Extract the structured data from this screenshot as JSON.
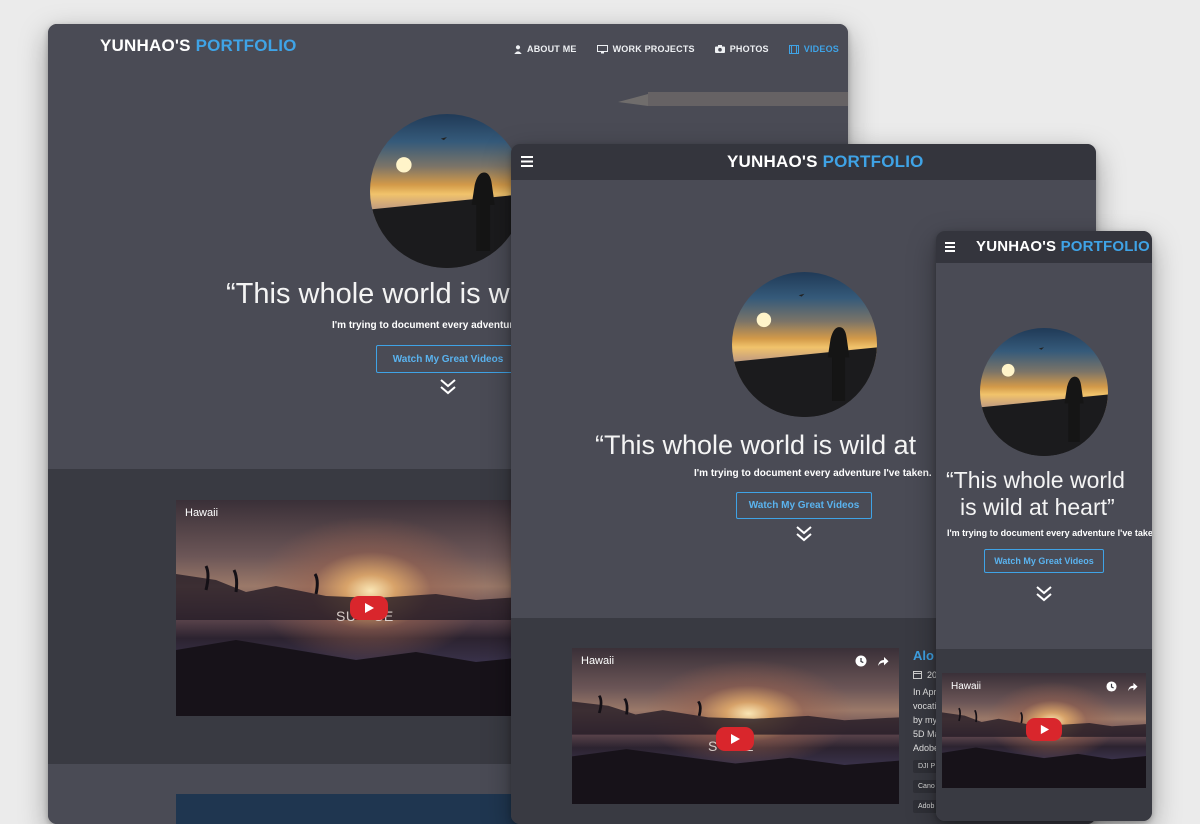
{
  "brand": {
    "name_prefix": "YUNHAO'S",
    "name_accent": "PORTFOLIO"
  },
  "nav": [
    {
      "label": "ABOUT ME",
      "icon": "person-icon"
    },
    {
      "label": "WORK PROJECTS",
      "icon": "monitor-icon"
    },
    {
      "label": "PHOTOS",
      "icon": "camera-icon"
    },
    {
      "label": "VIDEOS",
      "icon": "film-icon",
      "active": true
    }
  ],
  "hero": {
    "quote_desktop": "“This whole world is w",
    "quote_tablet": "“This whole world is wild at",
    "quote_mobile_line1": "“This whole world",
    "quote_mobile_line2": "is wild at heart”",
    "subtitle": "I'm trying to document every adventure I've taken.",
    "subtitle_desktop": "I'm trying to document every adventure",
    "cta_label": "Watch My Great Videos"
  },
  "video": {
    "title": "Hawaii",
    "overlay_word_desktop": "SU    SE",
    "overlay_word_tablet": "S      E"
  },
  "tablet_side": {
    "heading": "Alo",
    "meta": "20",
    "text_lines": [
      "In Apr",
      "vocati",
      "by my",
      "5D Ma",
      "Adobe"
    ],
    "tags": [
      "DJI P",
      "Cano",
      "Adob"
    ]
  },
  "colors": {
    "accent": "#3fa3e6",
    "hero_bg": "#4a4b55",
    "section_bg": "#393a42",
    "play_red": "#d9262c"
  }
}
